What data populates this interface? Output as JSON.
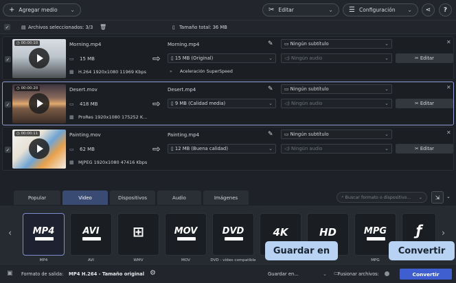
{
  "toolbar": {
    "add_media": "Agregar medio",
    "edit": "Editar",
    "settings": "Configuración",
    "help": "?"
  },
  "selection": {
    "label": "Archivos seleccionados: 3/3",
    "total": "Tamaño total: 36 MB"
  },
  "files": [
    {
      "time": "00:00:10",
      "name": "Morning.mp4",
      "size": "15 MB",
      "meta": "H.264 1920x1080 11969 Kbps",
      "output": "Morning.mp4",
      "quality": "15 MB (Original)",
      "extra": "Aceleración SuperSpeed",
      "subtitle": "Ningún subtítulo",
      "audio": "Ningún audio",
      "edit": "Editar"
    },
    {
      "time": "00:00:20",
      "name": "Desert.mov",
      "size": "418 MB",
      "meta": "ProRes 1920x1080 175252 K...",
      "output": "Desert.mp4",
      "quality": "9 MB (Calidad media)",
      "extra": "",
      "subtitle": "Ningún subtítulo",
      "audio": "Ningún audio",
      "edit": "Editar"
    },
    {
      "time": "00:00:11",
      "name": "Painting.mov",
      "size": "62 MB",
      "meta": "MJPEG 1920x1080 47416 Kbps",
      "output": "Painting.mp4",
      "quality": "12 MB (Buena calidad)",
      "extra": "",
      "subtitle": "Ningún subtítulo",
      "audio": "Ningún audio",
      "edit": "Editar"
    }
  ],
  "tabs": [
    "Popular",
    "Video",
    "Dispositivos",
    "Audio",
    "Imágenes"
  ],
  "active_tab": "Video",
  "search_placeholder": "Buscar formato o dispositivo...",
  "formats": [
    {
      "logo": "MP4",
      "label": "MP4"
    },
    {
      "logo": "AVI",
      "label": "AVI"
    },
    {
      "logo": "",
      "label": "WMV"
    },
    {
      "logo": "MOV",
      "label": "MOV"
    },
    {
      "logo": "DVD",
      "label": "DVD - vídeo compatible"
    },
    {
      "logo": "4K",
      "label": ""
    },
    {
      "logo": "HD",
      "label": ""
    },
    {
      "logo": "MPG",
      "label": "MPG"
    },
    {
      "logo": "",
      "label": ""
    }
  ],
  "status": {
    "output_label": "Formato de salida:",
    "output_value": "MP4 H.264 - Tamaño original",
    "save_to": "Guardar en...",
    "merge": "Fusionar archivos:",
    "convert": "Convertir"
  },
  "callouts": {
    "save": "Guardar en",
    "convert": "Convertir"
  },
  "colors": {
    "accent": "#394a73",
    "convert": "#3f5fd0",
    "callout": "#b7d2f2"
  }
}
